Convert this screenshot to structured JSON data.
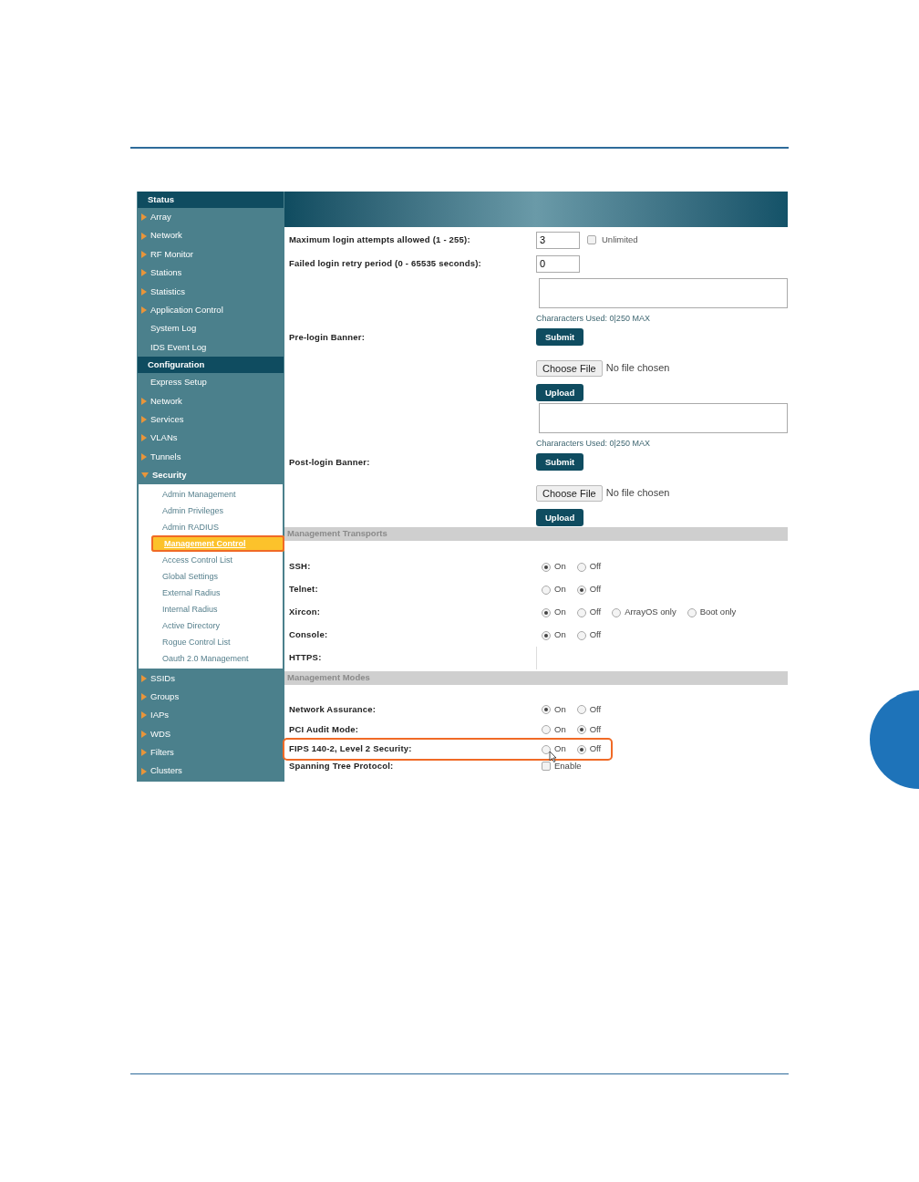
{
  "sidebar": {
    "sections": [
      {
        "title": "Status",
        "items": [
          {
            "label": "Array",
            "expandable": true,
            "expanded": false
          },
          {
            "label": "Network",
            "expandable": true,
            "expanded": false
          },
          {
            "label": "RF Monitor",
            "expandable": true,
            "expanded": false
          },
          {
            "label": "Stations",
            "expandable": true,
            "expanded": false
          },
          {
            "label": "Statistics",
            "expandable": true,
            "expanded": false
          },
          {
            "label": "Application Control",
            "expandable": true,
            "expanded": false
          },
          {
            "label": "System Log",
            "expandable": false,
            "expanded": false
          },
          {
            "label": "IDS Event Log",
            "expandable": false,
            "expanded": false
          }
        ]
      },
      {
        "title": "Configuration",
        "items": [
          {
            "label": "Express Setup",
            "expandable": false,
            "expanded": false
          },
          {
            "label": "Network",
            "expandable": true,
            "expanded": false
          },
          {
            "label": "Services",
            "expandable": true,
            "expanded": false
          },
          {
            "label": "VLANs",
            "expandable": true,
            "expanded": false
          },
          {
            "label": "Tunnels",
            "expandable": true,
            "expanded": false
          },
          {
            "label": "Security",
            "expandable": true,
            "expanded": true,
            "children": [
              {
                "label": "Admin Management",
                "selected": false
              },
              {
                "label": "Admin Privileges",
                "selected": false
              },
              {
                "label": "Admin RADIUS",
                "selected": false
              },
              {
                "label": "Management Control",
                "selected": true
              },
              {
                "label": "Access Control List",
                "selected": false
              },
              {
                "label": "Global Settings",
                "selected": false
              },
              {
                "label": "External Radius",
                "selected": false
              },
              {
                "label": "Internal Radius",
                "selected": false
              },
              {
                "label": "Active Directory",
                "selected": false
              },
              {
                "label": "Rogue Control List",
                "selected": false
              },
              {
                "label": "Oauth 2.0 Management",
                "selected": false
              }
            ]
          },
          {
            "label": "SSIDs",
            "expandable": true,
            "expanded": false
          },
          {
            "label": "Groups",
            "expandable": true,
            "expanded": false
          },
          {
            "label": "IAPs",
            "expandable": true,
            "expanded": false
          },
          {
            "label": "WDS",
            "expandable": true,
            "expanded": false
          },
          {
            "label": "Filters",
            "expandable": true,
            "expanded": false
          },
          {
            "label": "Clusters",
            "expandable": true,
            "expanded": false
          }
        ]
      }
    ]
  },
  "form": {
    "rows": [
      {
        "kind": "number",
        "label": "Maximum login attempts allowed (1 - 255):",
        "value": "3",
        "checkbox": {
          "label": "Unlimited",
          "checked": false
        }
      },
      {
        "kind": "number",
        "label": "Failed login retry period (0 - 65535 seconds):",
        "value": "0"
      },
      {
        "kind": "banner",
        "label": "Pre-login Banner:",
        "counter": "Chararacters Used: 0|250 MAX",
        "submit": "Submit",
        "file_button": "Choose File",
        "file_status": "No file chosen",
        "upload": "Upload"
      },
      {
        "kind": "banner",
        "label": "Post-login Banner:",
        "counter": "Chararacters Used: 0|250 MAX",
        "submit": "Submit",
        "file_button": "Choose File",
        "file_status": "No file chosen",
        "upload": "Upload"
      },
      {
        "kind": "section",
        "label": "Management Transports"
      },
      {
        "kind": "radio",
        "label": "SSH:",
        "highlighted": false,
        "options": [
          {
            "label": "On",
            "selected": true
          },
          {
            "label": "Off",
            "selected": false
          }
        ]
      },
      {
        "kind": "radio",
        "label": "Telnet:",
        "highlighted": false,
        "options": [
          {
            "label": "On",
            "selected": false
          },
          {
            "label": "Off",
            "selected": true
          }
        ]
      },
      {
        "kind": "radio",
        "label": "Xircon:",
        "highlighted": false,
        "options": [
          {
            "label": "On",
            "selected": true
          },
          {
            "label": "Off",
            "selected": false
          },
          {
            "label": "ArrayOS only",
            "selected": false
          },
          {
            "label": "Boot only",
            "selected": false
          }
        ]
      },
      {
        "kind": "radio",
        "label": "Console:",
        "highlighted": false,
        "options": [
          {
            "label": "On",
            "selected": true
          },
          {
            "label": "Off",
            "selected": false
          }
        ]
      },
      {
        "kind": "radio",
        "label": "HTTPS:",
        "highlighted": false
      },
      {
        "kind": "section",
        "label": "Management Modes"
      },
      {
        "kind": "radio",
        "label": "Network Assurance:",
        "highlighted": false,
        "options": [
          {
            "label": "On",
            "selected": true
          },
          {
            "label": "Off",
            "selected": false
          }
        ]
      },
      {
        "kind": "radio",
        "label": "PCI Audit Mode:",
        "highlighted": false,
        "options": [
          {
            "label": "On",
            "selected": false
          },
          {
            "label": "Off",
            "selected": true
          }
        ]
      },
      {
        "kind": "radio",
        "label": "FIPS 140-2, Level 2 Security:",
        "highlighted": true,
        "options": [
          {
            "label": "On",
            "selected": false
          },
          {
            "label": "Off",
            "selected": true
          }
        ]
      },
      {
        "kind": "check",
        "label": "Spanning Tree Protocol:",
        "highlighted": false,
        "checkbox": {
          "label": "Enable",
          "checked": false
        }
      }
    ]
  }
}
